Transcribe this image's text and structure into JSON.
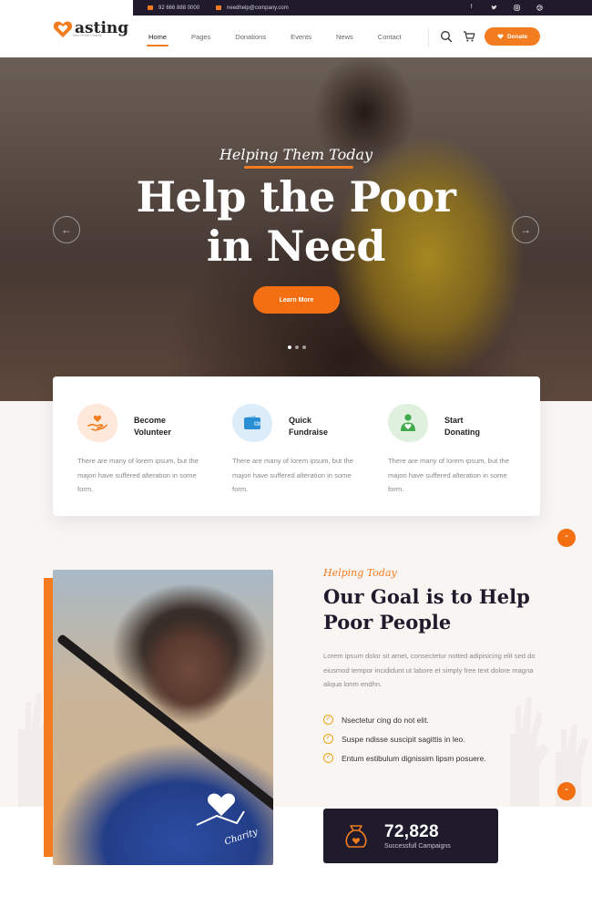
{
  "brand": {
    "name": "asting",
    "tagline": "Non Profit Charity"
  },
  "topbar": {
    "phone": "92 666 888 0000",
    "email": "needhelp@company.com",
    "socials": [
      "facebook-icon",
      "twitter-icon",
      "instagram-icon",
      "dribbble-icon"
    ]
  },
  "nav": {
    "items": [
      "Home",
      "Pages",
      "Donations",
      "Events",
      "News",
      "Contact"
    ],
    "active": "Home",
    "donate_label": "Donate"
  },
  "hero": {
    "subtitle": "Helping Them Today",
    "title_line1": "Help the Poor",
    "title_line2": "in Need",
    "button_label": "Learn More",
    "slide_count": 3,
    "active_slide": 1
  },
  "features": [
    {
      "title_line1": "Become",
      "title_line2": "Volunteer",
      "text": "There are many of lorem ipsum, but the majori have suffered alteration in some form.",
      "icon": "hand-heart-icon",
      "icon_bg": "#fde8da",
      "icon_color": "#f47c20"
    },
    {
      "title_line1": "Quick",
      "title_line2": "Fundraise",
      "text": "There are many of lorem ipsum, but the majori have suffered alteration in some form.",
      "icon": "wallet-icon",
      "icon_bg": "#dcecf8",
      "icon_color": "#2b8fd6"
    },
    {
      "title_line1": "Start",
      "title_line2": "Donating",
      "text": "There are many of lorem ipsum, but the majori have suffered alteration in some form.",
      "icon": "person-heart-icon",
      "icon_bg": "#dff1de",
      "icon_color": "#3fa94b"
    }
  ],
  "about": {
    "subtitle": "Helping Today",
    "title": "Our Goal is to Help Poor People",
    "text": "Lorem ipsum dolor sit amet, consectetur notted adipisicing elit sed do eiusmod tempor incididunt ut labore et simply free text dolore magna aliqua lonm endhn.",
    "checklist": [
      "Nsectetur cing do not elit.",
      "Suspe ndisse suscipit sagittis in leo.",
      "Entum estibulum dignissim lipsm posuere."
    ],
    "badge_text": "Charity"
  },
  "stat": {
    "value": "72,828",
    "label": "Successfull Campaigns"
  },
  "colors": {
    "accent": "#f47c20",
    "dark": "#1f1b2d"
  }
}
